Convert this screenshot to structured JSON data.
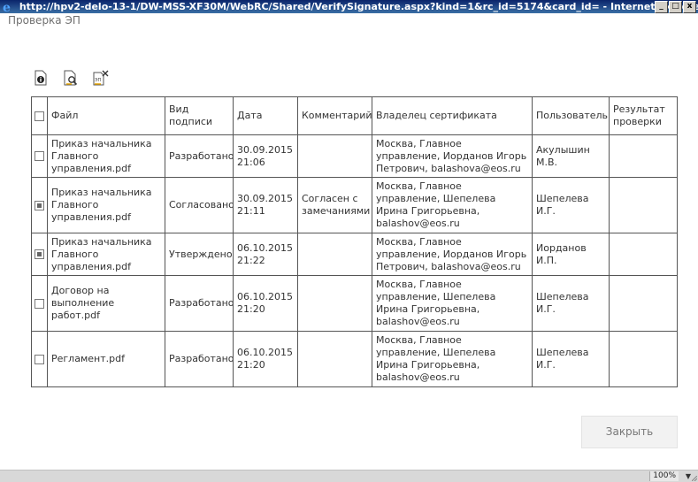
{
  "window": {
    "title": "http://hpv2-delo-13-1/DW-MSS-XF30M/WebRC/Shared/VerifySignature.aspx?kind=1&rc_id=5174&card_id= - Internet Explorer",
    "icon": "ie-icon",
    "controls": [
      "minimize-icon",
      "maximize-icon",
      "close-icon"
    ]
  },
  "header": {
    "title": "Проверка ЭП"
  },
  "toolbar": {
    "icons": [
      "info-document-icon",
      "view-signature-icon",
      "delete-signature-icon"
    ],
    "delete_icon_text": "ЭП"
  },
  "table": {
    "columns": [
      "Файл",
      "Вид подписи",
      "Дата",
      "Комментарий",
      "Владелец сертификата",
      "Пользователь",
      "Результат проверки"
    ],
    "rows": [
      {
        "checked": false,
        "file": "Приказ начальника Главного управления.pdf",
        "sign_type": "Разработано",
        "date": "30.09.2015 21:06",
        "comment": "",
        "owner": "Москва, Главное управление, Иорданов Игорь Петрович, balashova@eos.ru",
        "user": "Акулышин М.В.",
        "result": ""
      },
      {
        "checked": true,
        "file": "Приказ начальника Главного управления.pdf",
        "sign_type": "Согласовано",
        "date": "30.09.2015 21:11",
        "comment": "Согласен с замечаниями",
        "owner": "Москва, Главное управление, Шепелева Ирина Григорьевна, balashov@eos.ru",
        "user": "Шепелева И.Г.",
        "result": ""
      },
      {
        "checked": true,
        "file": "Приказ начальника Главного управления.pdf",
        "sign_type": "Утверждено",
        "date": "06.10.2015 21:22",
        "comment": "",
        "owner": "Москва, Главное управление, Иорданов Игорь Петрович, balashova@eos.ru",
        "user": "Иорданов И.П.",
        "result": ""
      },
      {
        "checked": false,
        "file": "Договор на выполнение работ.pdf",
        "sign_type": "Разработано",
        "date": "06.10.2015 21:20",
        "comment": "",
        "owner": "Москва, Главное управление, Шепелева Ирина Григорьевна, balashov@eos.ru",
        "user": "Шепелева И.Г.",
        "result": ""
      },
      {
        "checked": false,
        "file": "Регламент.pdf",
        "sign_type": "Разработано",
        "date": "06.10.2015 21:20",
        "comment": "",
        "owner": "Москва, Главное управление, Шепелева Ирина Григорьевна, balashov@eos.ru",
        "user": "Шепелева И.Г.",
        "result": ""
      }
    ]
  },
  "buttons": {
    "close": "Закрыть"
  },
  "statusbar": {
    "zoom": "100%"
  },
  "colors": {
    "titlebar": "#0a246a",
    "statusbar": "#d8d8d8",
    "header_text": "#707070"
  }
}
